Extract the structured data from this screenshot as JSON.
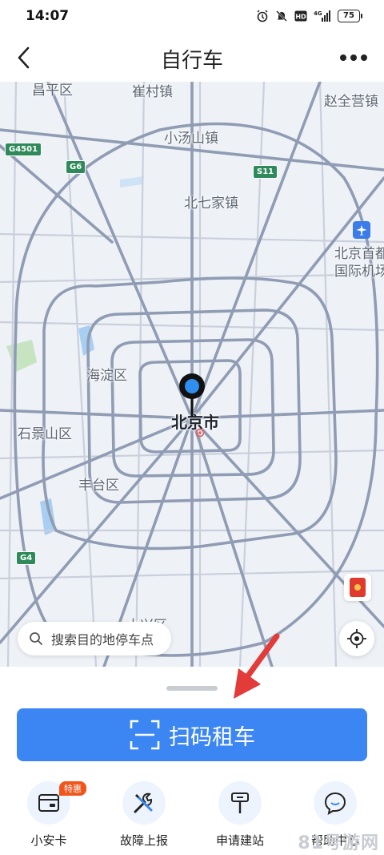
{
  "status": {
    "time": "14:07",
    "battery": "75",
    "network": "4G"
  },
  "header": {
    "title": "自行车"
  },
  "map": {
    "labels": {
      "changping": "昌平区",
      "cuncun": "崔村镇",
      "zhaoquanying": "赵全营镇",
      "xiaotangshan": "小汤山镇",
      "beiqijia": "北七家镇",
      "airport_1": "北京首都",
      "airport_2": "国际机场",
      "haidian": "海淀区",
      "beijing": "北京市",
      "shijingshan": "石景山区",
      "fengtai": "丰台区",
      "daxing": "大兴区"
    },
    "shields": {
      "g4501": "G4501",
      "g6": "G6",
      "s11": "S11",
      "g4": "G4"
    }
  },
  "search": {
    "placeholder": "搜索目的地停车点"
  },
  "scan_button": {
    "label": "扫码租车"
  },
  "menu": [
    {
      "label": "小安卡",
      "badge": "特惠",
      "icon": "card-icon"
    },
    {
      "label": "故障上报",
      "icon": "tools-icon"
    },
    {
      "label": "申请建站",
      "icon": "station-sign-icon"
    },
    {
      "label": "帮助中心",
      "icon": "chat-bubble-icon"
    }
  ],
  "watermark": "81号游网",
  "colors": {
    "accent": "#3b86f2",
    "badge": "#f2551c",
    "arrow": "#e33a3a"
  }
}
